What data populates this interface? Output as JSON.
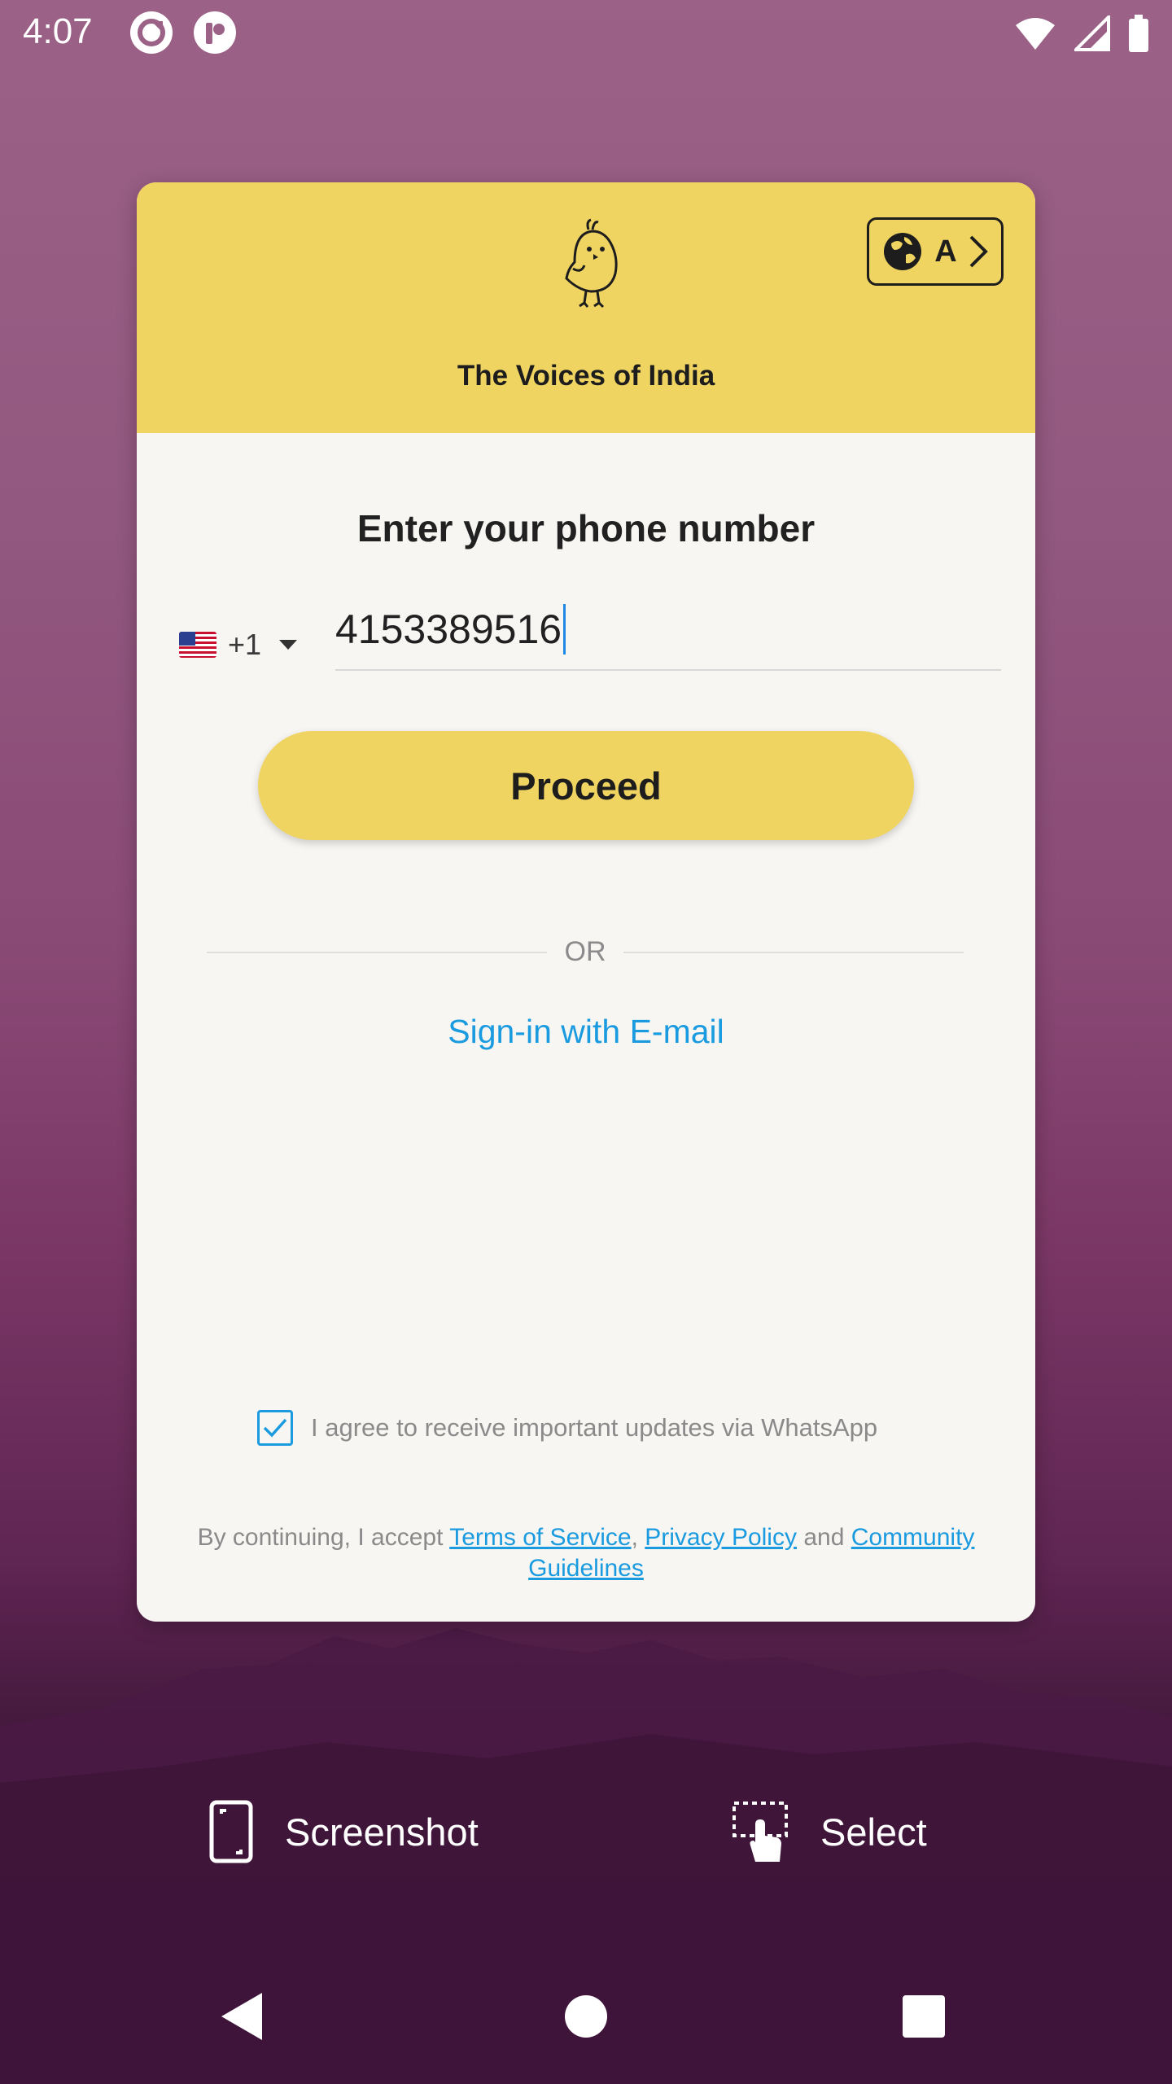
{
  "status_bar": {
    "time": "4:07"
  },
  "header": {
    "tagline": "The Voices of India",
    "language_button_letter": "A"
  },
  "form": {
    "title": "Enter your phone number",
    "country_code": "+1",
    "phone_value": "4153389516",
    "proceed_label": "Proceed",
    "or_label": "OR",
    "email_link": "Sign-in with E-mail",
    "whatsapp_consent": "I agree to receive important updates via WhatsApp",
    "whatsapp_checked": true
  },
  "legal": {
    "prefix": "By continuing, I accept ",
    "terms": "Terms of Service",
    "comma": ", ",
    "privacy": "Privacy Policy",
    "and": " and ",
    "community": "Community Guidelines"
  },
  "overlay_actions": {
    "screenshot_label": "Screenshot",
    "select_label": "Select"
  },
  "colors": {
    "accent_yellow": "#f0d462",
    "link_blue": "#1a9be0"
  }
}
